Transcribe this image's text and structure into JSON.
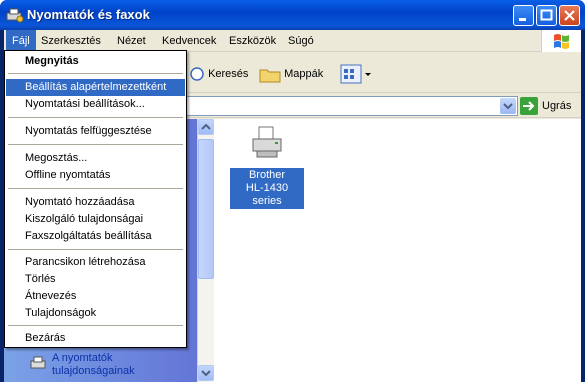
{
  "window": {
    "title": "Nyomtatók és faxok"
  },
  "menubar": {
    "items": [
      "Fájl",
      "Szerkesztés",
      "Nézet",
      "Kedvencek",
      "Eszközök",
      "Súgó"
    ]
  },
  "toolbar": {
    "search_label": "Keresés",
    "folders_label": "Mappák"
  },
  "addressbar": {
    "value": "",
    "go_label": "Ugrás"
  },
  "file_menu": {
    "items": [
      "Megnyitás",
      "Beállítás alapértelmezettként",
      "Nyomtatási beállítások...",
      "Nyomtatás felfüggesztése",
      "Megosztás...",
      "Offline nyomtatás",
      "Nyomtató hozzáadása",
      "Kiszolgáló tulajdonságai",
      "Faxszolgáltatás beállítása",
      "Parancsikon létrehozása",
      "Törlés",
      "Átnevezés",
      "Tulajdonságok",
      "Bezárás"
    ]
  },
  "content": {
    "printer_line1": "Brother",
    "printer_line2": "HL-1430 series"
  },
  "tasks": {
    "printer_properties_line1": "A nyomtatók",
    "printer_properties_line2": "tulajdonságainak"
  },
  "colors": {
    "accent": "#316ac5",
    "titlebar": "#0043c8",
    "taskpane": "#6375d6"
  }
}
